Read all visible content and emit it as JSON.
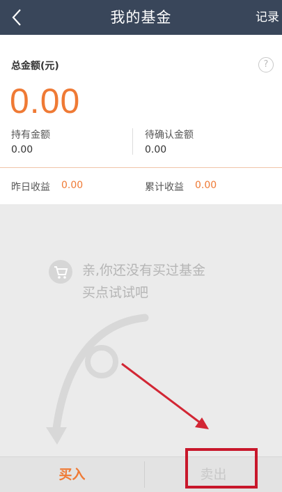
{
  "header": {
    "title": "我的基金",
    "records_label": "记录"
  },
  "summary": {
    "total_label": "总金额(元)",
    "total_amount": "0.00",
    "help_symbol": "?",
    "holding_label": "持有金额",
    "holding_value": "0.00",
    "pending_label": "待确认金额",
    "pending_value": "0.00"
  },
  "income": {
    "yesterday_label": "昨日收益",
    "yesterday_value": "0.00",
    "cumulative_label": "累计收益",
    "cumulative_value": "0.00"
  },
  "empty_state": {
    "line1": "亲,你还没有买过基金",
    "line2": "买点试试吧",
    "icon": "shopping-cart-icon"
  },
  "bottom_bar": {
    "buy_label": "买入",
    "sell_label": "卖出"
  },
  "colors": {
    "header_bg": "#39465a",
    "accent_orange": "#ef7a35",
    "annotation_red": "#c8172b"
  }
}
